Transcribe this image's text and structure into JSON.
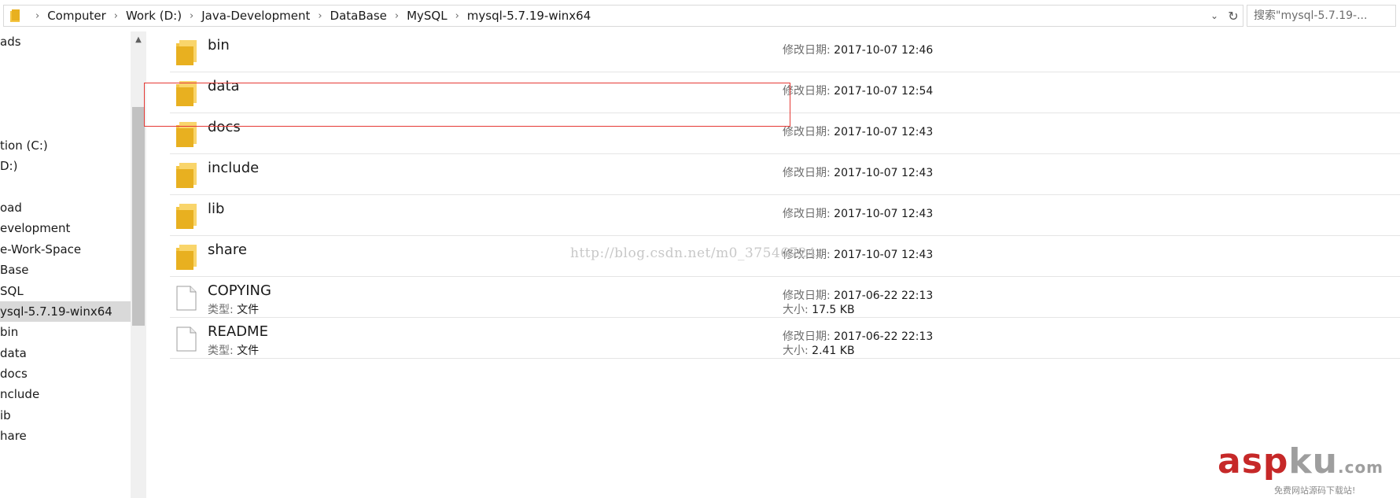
{
  "address_bar": {
    "breadcrumbs": [
      "Computer",
      "Work (D:)",
      "Java-Development",
      "DataBase",
      "MySQL",
      "mysql-5.7.19-winx64"
    ],
    "search_placeholder": "搜索\"mysql-5.7.19-..."
  },
  "nav_pane": {
    "items": [
      {
        "label": "ads",
        "selected": false
      },
      {
        "label": "tion (C:)",
        "selected": false
      },
      {
        "label": "D:)",
        "selected": false
      },
      {
        "label": "oad",
        "selected": false
      },
      {
        "label": "evelopment",
        "selected": false
      },
      {
        "label": "e-Work-Space",
        "selected": false
      },
      {
        "label": "Base",
        "selected": false
      },
      {
        "label": "SQL",
        "selected": false
      },
      {
        "label": "ysql-5.7.19-winx64",
        "selected": true
      },
      {
        "label": "bin",
        "selected": false
      },
      {
        "label": "data",
        "selected": false
      },
      {
        "label": "docs",
        "selected": false
      },
      {
        "label": "nclude",
        "selected": false
      },
      {
        "label": "ib",
        "selected": false
      },
      {
        "label": "hare",
        "selected": false
      }
    ]
  },
  "files": [
    {
      "name": "bin",
      "kind": "folder",
      "date_label": "修改日期:",
      "date": "2017-10-07 12:46"
    },
    {
      "name": "data",
      "kind": "folder",
      "date_label": "修改日期:",
      "date": "2017-10-07 12:54"
    },
    {
      "name": "docs",
      "kind": "folder",
      "date_label": "修改日期:",
      "date": "2017-10-07 12:43"
    },
    {
      "name": "include",
      "kind": "folder",
      "date_label": "修改日期:",
      "date": "2017-10-07 12:43"
    },
    {
      "name": "lib",
      "kind": "folder",
      "date_label": "修改日期:",
      "date": "2017-10-07 12:43"
    },
    {
      "name": "share",
      "kind": "folder",
      "date_label": "修改日期:",
      "date": "2017-10-07 12:43"
    },
    {
      "name": "COPYING",
      "kind": "file",
      "type_label": "类型:",
      "type": "文件",
      "date_label": "修改日期:",
      "date": "2017-06-22 22:13",
      "size_label": "大小:",
      "size": "17.5 KB"
    },
    {
      "name": "README",
      "kind": "file",
      "type_label": "类型:",
      "type": "文件",
      "date_label": "修改日期:",
      "date": "2017-06-22 22:13",
      "size_label": "大小:",
      "size": "2.41 KB"
    }
  ],
  "watermark": "http://blog.csdn.net/m0_37546724",
  "logo": {
    "text_a": "asp",
    "text_b": "ku",
    "suffix": ".com",
    "sub": "免费网站源码下载站!"
  },
  "colors": {
    "highlight": "#e53935",
    "folder": "#f4c542",
    "selection": "#d9d9d9"
  }
}
